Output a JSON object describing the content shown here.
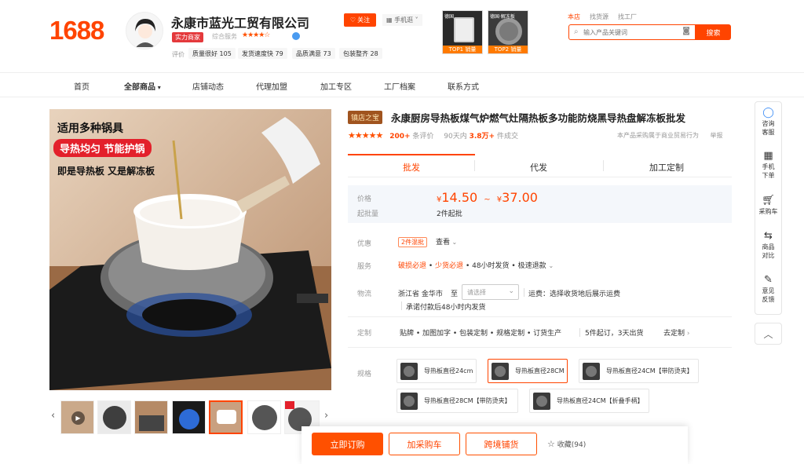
{
  "header": {
    "logo": "1688",
    "shop_name": "永康市蓝光工贸有限公司",
    "strength_badge": "实力商家",
    "service_label": "综合服务",
    "service_stars": "★★★★☆",
    "eval_label": "评价",
    "eval_items": [
      "质量很好 105",
      "发货速度快 79",
      "品质满意 73",
      "包装整齐 28"
    ],
    "follow": "关注",
    "mobile": "手机逛",
    "top_thumbs": [
      {
        "top_text": "德国",
        "tag": "TOP1 销量"
      },
      {
        "top_text": "德国·解冻板",
        "tag": "TOP2 销量"
      }
    ],
    "search_tabs": [
      "本店",
      "找货源",
      "找工厂"
    ],
    "search_placeholder": "输入产品关键词",
    "search_button": "搜索"
  },
  "nav": [
    "首页",
    "全部商品",
    "店铺动态",
    "代理加盟",
    "加工专区",
    "工厂档案",
    "联系方式"
  ],
  "main_image": {
    "line1": "适用多种锅具",
    "line2": "导热均匀 节能护锅",
    "line3": "即是导热板 又是解冻板"
  },
  "product": {
    "tag": "镇店之宝",
    "title": "永康厨房导热板煤气炉燃气灶隔热板多功能防烧黑导热盘解冻板批发",
    "stars": "★★★★★",
    "review_count": "200+",
    "review_suffix": "条评价",
    "deals_prefix": "90天内",
    "deals_count": "3.8万+",
    "deals_suffix": "件成交",
    "notice": "本产品采购属于商业贸易行为",
    "report": "举报"
  },
  "tabs": [
    "批发",
    "代发",
    "加工定制"
  ],
  "pricing": {
    "price_label": "价格",
    "price_low": "14.50",
    "price_sep": "~",
    "price_high": "37.00",
    "currency": "¥",
    "moq_label": "起批量",
    "moq_value": "2件起批"
  },
  "offers": {
    "label": "优惠",
    "pill": "2件混批",
    "view": "查看"
  },
  "service": {
    "label": "服务",
    "item1": "破损必退",
    "item2": "少货必退",
    "rest": "• 48小时发货 • 极速退款"
  },
  "logistics": {
    "label": "物流",
    "from": "浙江省 金华市",
    "to_label": "至",
    "select_placeholder": "请选择",
    "freight": "运费：选择收货地后展示运费",
    "promise": "承诺付款后48小时内发货"
  },
  "custom": {
    "label": "定制",
    "items": "贴牌 • 加图加字 • 包装定制 • 规格定制 • 订货生产",
    "moq": "5件起订，3天出货",
    "link": "去定制"
  },
  "specs": {
    "label": "规格",
    "options": [
      "导热板直径24cm",
      "导热板直径28CM",
      "导热板直径24CM【带防烫夹】",
      "导热板直径28CM【带防烫夹】",
      "导热板直径24CM【折叠手柄】"
    ]
  },
  "sidebar": [
    "咨询客服",
    "手机下单",
    "采购车",
    "商品对比",
    "意见反馈"
  ],
  "actions": {
    "buy": "立即订购",
    "cart": "加采购车",
    "cross": "跨境铺货",
    "fav": "收藏(94)"
  }
}
